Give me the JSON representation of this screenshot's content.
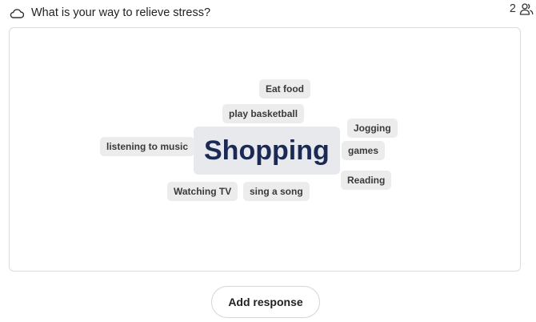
{
  "header": {
    "question": "What is your way to relieve stress?",
    "participants_count": "2"
  },
  "word_cloud": {
    "words": [
      {
        "text": "Eat food",
        "size": "small"
      },
      {
        "text": "play basketball",
        "size": "small"
      },
      {
        "text": "Jogging",
        "size": "small"
      },
      {
        "text": "listening to music",
        "size": "small"
      },
      {
        "text": "Shopping",
        "size": "large"
      },
      {
        "text": "games",
        "size": "small"
      },
      {
        "text": "Reading",
        "size": "small"
      },
      {
        "text": "Watching TV",
        "size": "small"
      },
      {
        "text": "sing a song",
        "size": "small"
      }
    ],
    "colors": {
      "chip_background": "#ececec",
      "chip_text": "#3a3a3a",
      "highlight_text": "#1b2a55"
    }
  },
  "actions": {
    "add_response_label": "Add response"
  },
  "icons": {
    "question_icon": "cloud-icon",
    "participants_icon": "users-icon"
  }
}
